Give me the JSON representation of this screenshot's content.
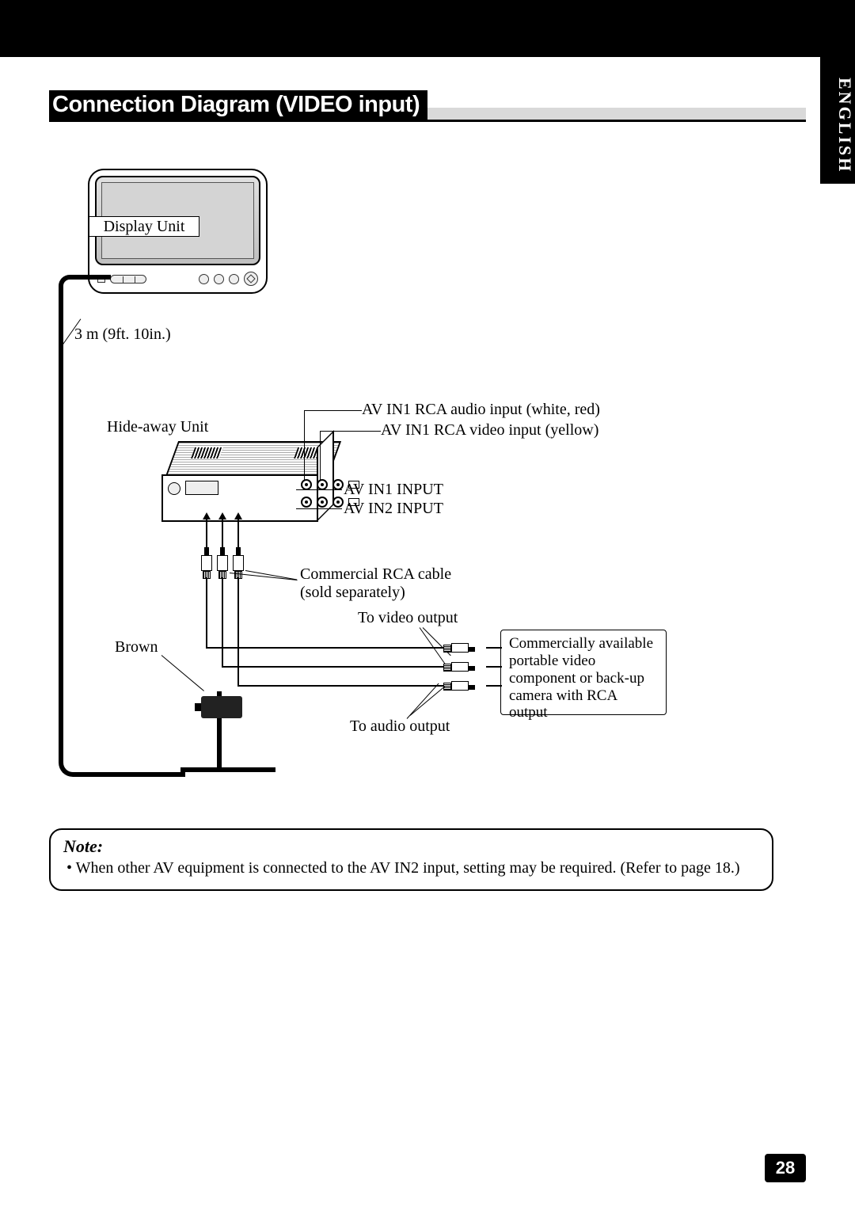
{
  "page": {
    "title": "Connection Diagram (VIDEO input)",
    "language_tab": "ENGLISH",
    "number": "28"
  },
  "diagram": {
    "display_unit_label": "Display Unit",
    "cable_length": "3 m (9ft. 10in.)",
    "hideaway_label": "Hide-away Unit",
    "av_in1_audio": "AV IN1 RCA audio input (white, red)",
    "av_in1_video": "AV IN1 RCA video input (yellow)",
    "av_in1_input": "AV IN1 INPUT",
    "av_in2_input": "AV IN2 INPUT",
    "rca_cable_line1": "Commercial RCA cable",
    "rca_cable_line2": "(sold separately)",
    "to_video_output": "To video output",
    "to_audio_output": "To audio output",
    "brown": "Brown",
    "component_box": "Commercially available portable video component or back-up camera with RCA output"
  },
  "note": {
    "heading": "Note:",
    "bullet": "•  When other AV equipment is connected to the AV IN2 input, setting may be required. (Refer to page 18.)"
  }
}
